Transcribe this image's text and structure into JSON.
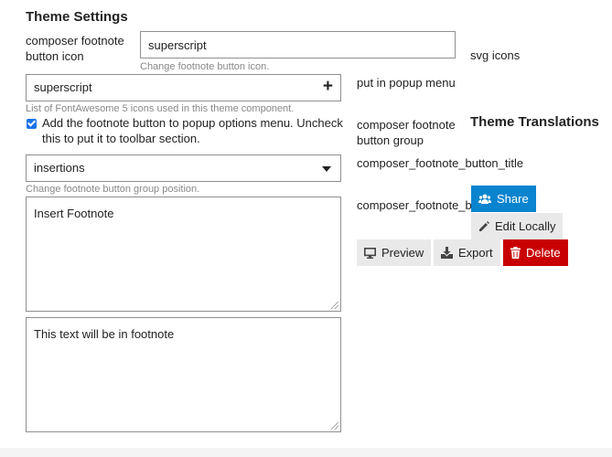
{
  "theme_settings": {
    "heading": "Theme Settings",
    "button_icon": {
      "label": "composer footnote button icon",
      "value": "superscript",
      "help": "Change footnote button icon."
    },
    "svg_icons": {
      "label": "svg icons",
      "value": "superscript",
      "help": "List of FontAwesome 5 icons used in this theme component."
    },
    "popup_menu": {
      "label": "put in popup menu",
      "checked": true,
      "description": "Add the footnote button to popup options menu. Uncheck this to put it to toolbar section."
    },
    "button_group": {
      "label": "composer footnote button group",
      "value": "insertions",
      "help": "Change footnote button group position."
    }
  },
  "theme_translations": {
    "heading": "Theme Translations",
    "button_title": {
      "label": "composer_footnote_button_title",
      "value": "Insert Footnote"
    },
    "footnote_text": {
      "label": "composer_footnote_bu",
      "value": "This text will be in footnote"
    }
  },
  "actions": {
    "share": "Share",
    "edit_locally": "Edit Locally",
    "preview": "Preview",
    "export": "Export",
    "delete": "Delete"
  },
  "colors": {
    "share_bg": "#0a84cf",
    "delete_bg": "#c80001",
    "secondary_bg": "#e9e9e9",
    "checkbox": "#1a73e8"
  },
  "icons": {
    "share": "users-icon",
    "edit_locally": "pencil-icon",
    "preview": "desktop-icon",
    "export": "download-icon",
    "delete": "trash-icon",
    "list_add": "plus-icon",
    "select": "caret-down-icon"
  }
}
